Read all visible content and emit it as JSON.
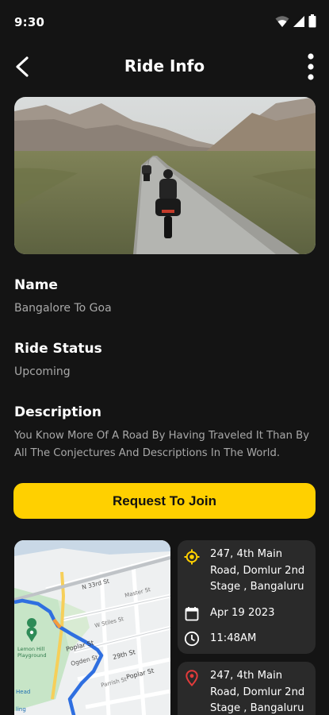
{
  "status": {
    "time": "9:30"
  },
  "header": {
    "title": "Ride Info"
  },
  "ride": {
    "name_label": "Name",
    "name_value": "Bangalore To Goa",
    "status_label": "Ride Status",
    "status_value": "Upcoming",
    "description_label": "Description",
    "description_value": "You Know More Of A Road By Having Traveled It Than By All The Conjectures And Descriptions In The World."
  },
  "actions": {
    "join_label": "Request To Join"
  },
  "map": {
    "streets": [
      "N 33rd St",
      "Master St",
      "W Stiles St",
      "Poplar St",
      "Ogden St",
      "29th St",
      "Parrish St",
      "Poplar St"
    ],
    "poi": [
      "Lemon Hill",
      "Playground",
      "Head",
      "ling"
    ]
  },
  "start_point": {
    "address": "247, 4th Main Road, Domlur 2nd Stage , Bangaluru",
    "date": "Apr 19 2023",
    "time": "11:48AM"
  },
  "end_point": {
    "address": "247, 4th Main Road, Domlur 2nd Stage , Bangaluru"
  },
  "colors": {
    "accent": "#ffd000",
    "background": "#141414",
    "card": "#2a2a2a",
    "muted": "#a8a8a8",
    "pin": "#e23b3b"
  }
}
